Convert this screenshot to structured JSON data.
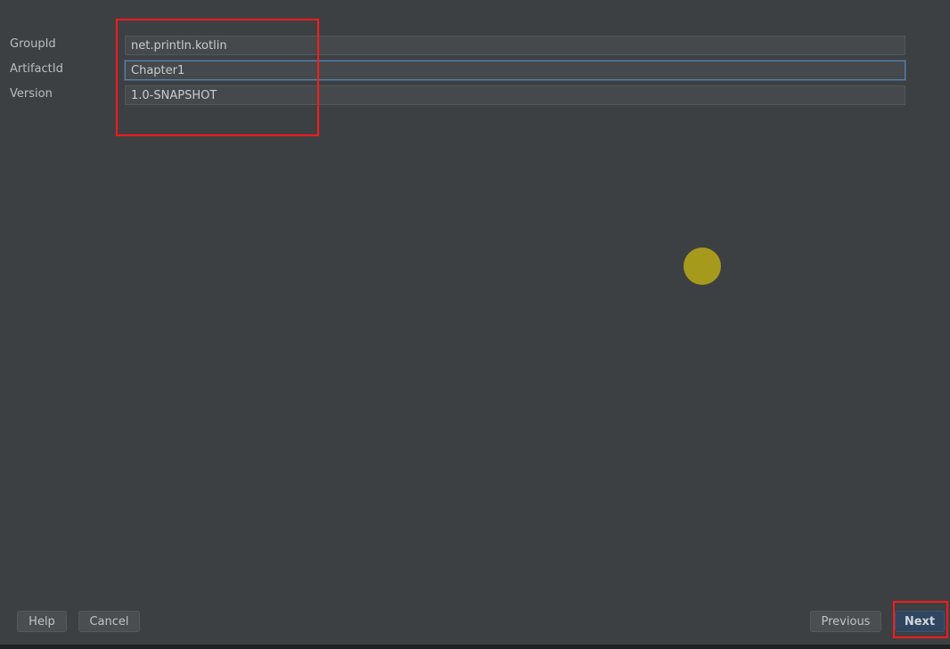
{
  "form": {
    "fields": [
      {
        "label": "GroupId",
        "value": "net.println.kotlin"
      },
      {
        "label": "ArtifactId",
        "value": "Chapter1"
      },
      {
        "label": "Version",
        "value": "1.0-SNAPSHOT"
      }
    ]
  },
  "footer": {
    "help": "Help",
    "cancel": "Cancel",
    "previous": "Previous",
    "next": "Next"
  },
  "colors": {
    "highlight": "#ff1a1a",
    "cursor_dot": "#a59a1c",
    "primary_button": "#2f4560"
  }
}
